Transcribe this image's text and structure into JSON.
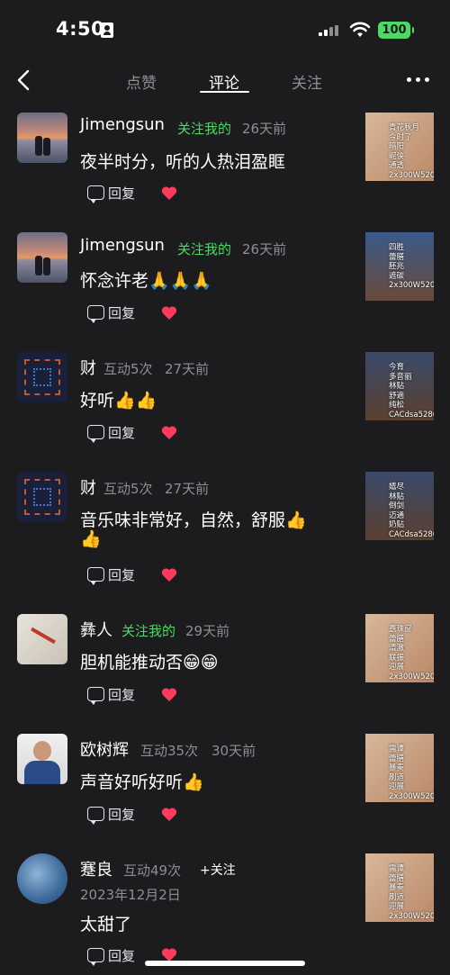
{
  "status": {
    "time": "4:50",
    "battery": "100"
  },
  "nav": {
    "tabs": [
      "点赞",
      "评论",
      "关注"
    ],
    "active_tab": "评论"
  },
  "comments": [
    {
      "name": "Jimengsun",
      "tag": "关注我的",
      "time": "26天前",
      "text": "夜半时分，听的人热泪盈眶",
      "reply": "回复",
      "thumb": "青花秋月\n今时了\n暗阳\n昵侠\n通透\n2x300W5201"
    },
    {
      "name": "Jimengsun",
      "tag": "关注我的",
      "time": "26天前",
      "text": "怀念许老🙏🙏🙏",
      "reply": "回复",
      "thumb": "四胜\n蕾膳\n胚兆\n遮碳\n2x300W5201"
    },
    {
      "name": "财",
      "tag": "互动5次",
      "time": "27天前",
      "text": "好听👍👍",
      "reply": "回复",
      "thumb": "今育\n多音丽\n林贴\n舒適\n纯松\nCACdsa5280"
    },
    {
      "name": "财",
      "tag": "互动5次",
      "time": "27天前",
      "text": "音乐味非常好，自然，舒服👍",
      "text2": "👍",
      "reply": "回复",
      "thumb": "嬉尽\n林贴\n倒剑\n迈通\n奶贴\nCACdsa5280"
    },
    {
      "name": "彝人",
      "tag": "关注我的",
      "time": "29天前",
      "text": "胆机能推动否😁😁",
      "reply": "回复",
      "thumb": "嘉珠窗\n蕾膳\n清澈\n联振\n迎展\n2x300W5201"
    },
    {
      "name": "欧树辉",
      "tag": "互动35次",
      "time": "30天前",
      "text": "声音好听好听👍",
      "reply": "回复",
      "thumb": "需谭\n蕾膳\n暴奏\n刷适\n迎展\n2x300W5201"
    },
    {
      "name": "蹇良",
      "tag": "互动49次",
      "follow": "+关注",
      "time": "2023年12月2日",
      "text": "太甜了",
      "reply": "回复",
      "thumb": "需谭\n蕾膳\n暴奏\n刷适\n迎展\n2x300W5201"
    }
  ],
  "colors": {
    "background": "#1c1c1e",
    "accent_green": "#4cd964",
    "heart": "#ff3b5c",
    "muted": "#8e8e93"
  },
  "icons": [
    "back-icon",
    "more-icon",
    "reply-icon",
    "heart-icon",
    "signal-icon",
    "wifi-icon"
  ]
}
